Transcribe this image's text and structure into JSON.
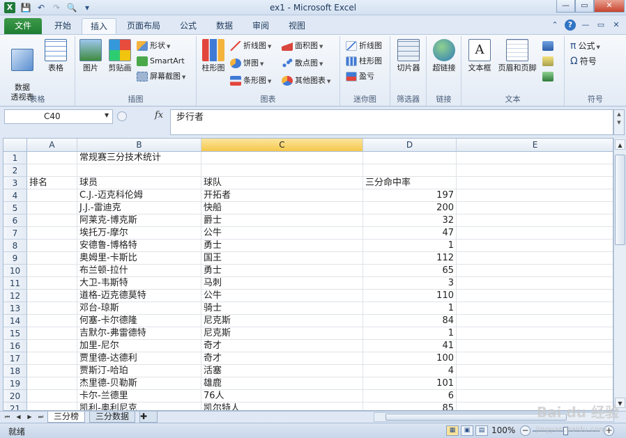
{
  "window": {
    "title": "ex1  -  Microsoft Excel",
    "app_letter": "X"
  },
  "qat": {
    "save": "💾",
    "undo": "↶",
    "redo": "↷",
    "print_preview": "🔍",
    "customize": "▾"
  },
  "win_ctrls": {
    "minimize": "—",
    "restore": "▭",
    "close": "✕"
  },
  "ribbon_tabs": [
    {
      "label": "文件"
    },
    {
      "label": "开始"
    },
    {
      "label": "插入"
    },
    {
      "label": "页面布局"
    },
    {
      "label": "公式"
    },
    {
      "label": "数据"
    },
    {
      "label": "审阅"
    },
    {
      "label": "视图"
    }
  ],
  "active_tab": "插入",
  "groups": {
    "tables": {
      "label": "表格",
      "pivot": "数据\n透视表",
      "table": "表格"
    },
    "illustrations": {
      "label": "插图",
      "picture": "图片",
      "clipart": "剪贴画",
      "shapes": "形状",
      "smartart": "SmartArt",
      "screenshot": "屏幕截图"
    },
    "charts": {
      "label": "图表",
      "column": "柱形图",
      "line": "折线图",
      "pie": "饼图",
      "bar": "条形图",
      "area": "面积图",
      "scatter": "散点图",
      "other": "其他图表"
    },
    "sparklines": {
      "label": "迷你图",
      "line": "折线图",
      "column": "柱形图",
      "winloss": "盈亏"
    },
    "filter": {
      "label": "筛选器",
      "slicer": "切片器"
    },
    "links": {
      "label": "链接",
      "hyperlink": "超链接"
    },
    "text": {
      "label": "文本",
      "textbox": "文本框",
      "header_footer": "页眉和页脚"
    },
    "symbols": {
      "label": "符号",
      "equation": "公式",
      "symbol": "符号"
    }
  },
  "formula_bar": {
    "name_box": "C40",
    "fx": "fx",
    "content": "步行者"
  },
  "columns": [
    "A",
    "B",
    "C",
    "D",
    "E"
  ],
  "selected_column": "C",
  "rows": [
    {
      "n": "1",
      "a": "",
      "b": "常规赛三分技术统计",
      "c": "",
      "d": ""
    },
    {
      "n": "2",
      "a": "",
      "b": "",
      "c": "",
      "d": ""
    },
    {
      "n": "3",
      "a": "排名",
      "b": "球员",
      "c": "球队",
      "d": "三分命中率"
    },
    {
      "n": "4",
      "a": "",
      "b": "C.J.-迈克科伦姆",
      "c": "开拓者",
      "d": "197"
    },
    {
      "n": "5",
      "a": "",
      "b": "J.J.-雷迪克",
      "c": "快船",
      "d": "200"
    },
    {
      "n": "6",
      "a": "",
      "b": "阿莱克-博克斯",
      "c": "爵士",
      "d": "32"
    },
    {
      "n": "7",
      "a": "",
      "b": "埃托万-摩尔",
      "c": "公牛",
      "d": "47"
    },
    {
      "n": "8",
      "a": "",
      "b": "安德鲁-博格特",
      "c": "勇士",
      "d": "1"
    },
    {
      "n": "9",
      "a": "",
      "b": "奥姆里-卡斯比",
      "c": "国王",
      "d": "112"
    },
    {
      "n": "10",
      "a": "",
      "b": "布兰顿-拉什",
      "c": "勇士",
      "d": "65"
    },
    {
      "n": "11",
      "a": "",
      "b": "大卫-韦斯特",
      "c": "马刺",
      "d": "3"
    },
    {
      "n": "12",
      "a": "",
      "b": "道格-迈克德莫特",
      "c": "公牛",
      "d": "110"
    },
    {
      "n": "13",
      "a": "",
      "b": "邓台-琼斯",
      "c": "骑士",
      "d": "1"
    },
    {
      "n": "14",
      "a": "",
      "b": "何塞-卡尔德隆",
      "c": "尼克斯",
      "d": "84"
    },
    {
      "n": "15",
      "a": "",
      "b": "吉默尔-弗雷德特",
      "c": "尼克斯",
      "d": "1"
    },
    {
      "n": "16",
      "a": "",
      "b": "加里-尼尔",
      "c": "奇才",
      "d": "41"
    },
    {
      "n": "17",
      "a": "",
      "b": "贾里德-达德利",
      "c": "奇才",
      "d": "100"
    },
    {
      "n": "18",
      "a": "",
      "b": "贾斯汀-哈珀",
      "c": "活塞",
      "d": "4"
    },
    {
      "n": "19",
      "a": "",
      "b": "杰里德-贝勒斯",
      "c": "雄鹿",
      "d": "101"
    },
    {
      "n": "20",
      "a": "",
      "b": "卡尔-兰德里",
      "c": "76人",
      "d": "6"
    },
    {
      "n": "21",
      "a": "",
      "b": "凯利-奥利尼克",
      "c": "凯尔特人",
      "d": "85"
    }
  ],
  "sheets": [
    {
      "label": "三分榜",
      "active": true
    },
    {
      "label": "三分数据",
      "active": false
    }
  ],
  "status": {
    "ready": "就绪",
    "zoom": "100%",
    "zoom_minus": "−",
    "zoom_plus": "+"
  },
  "watermark": {
    "main": "Bai du 经验",
    "sub": "jingyan.baidu.com"
  }
}
